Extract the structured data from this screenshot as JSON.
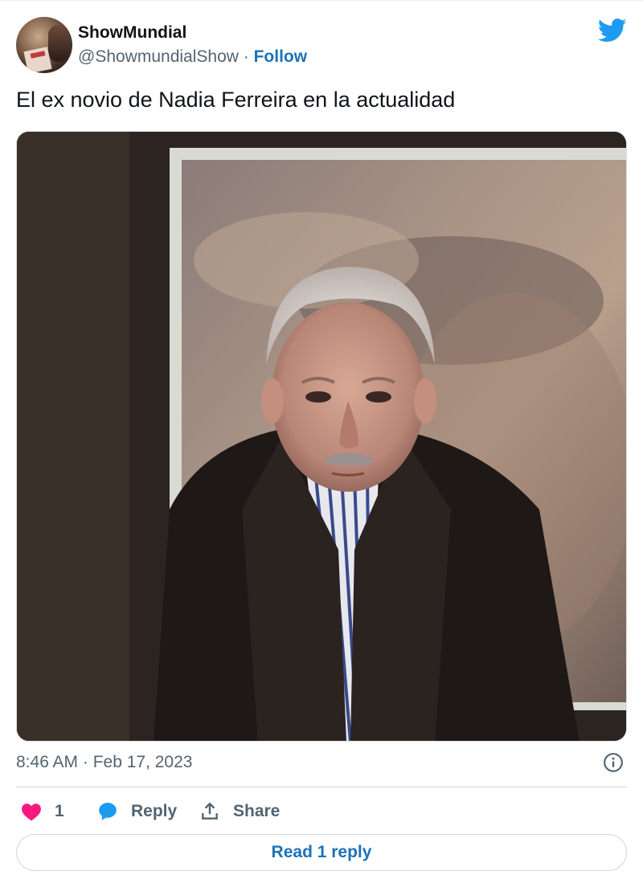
{
  "author": {
    "name": "ShowMundial",
    "handle": "@ShowmundialShow",
    "separator": "·",
    "follow_label": "Follow"
  },
  "tweet": {
    "text": "El ex novio de Nadia Ferreira en la actualidad",
    "timestamp": "8:46 AM · Feb 17, 2023"
  },
  "actions": {
    "like_count": "1",
    "reply_label": "Reply",
    "share_label": "Share"
  },
  "read_reply_label": "Read 1 reply",
  "icons": {
    "brand": "twitter-bird-icon",
    "info": "info-icon",
    "like": "heart-icon",
    "reply": "speech-bubble-icon",
    "share": "share-arrow-icon"
  },
  "colors": {
    "twitter_blue": "#1d9bf0",
    "link_blue": "#1d72b8",
    "like_pink": "#f91880",
    "secondary_text": "#536471"
  }
}
